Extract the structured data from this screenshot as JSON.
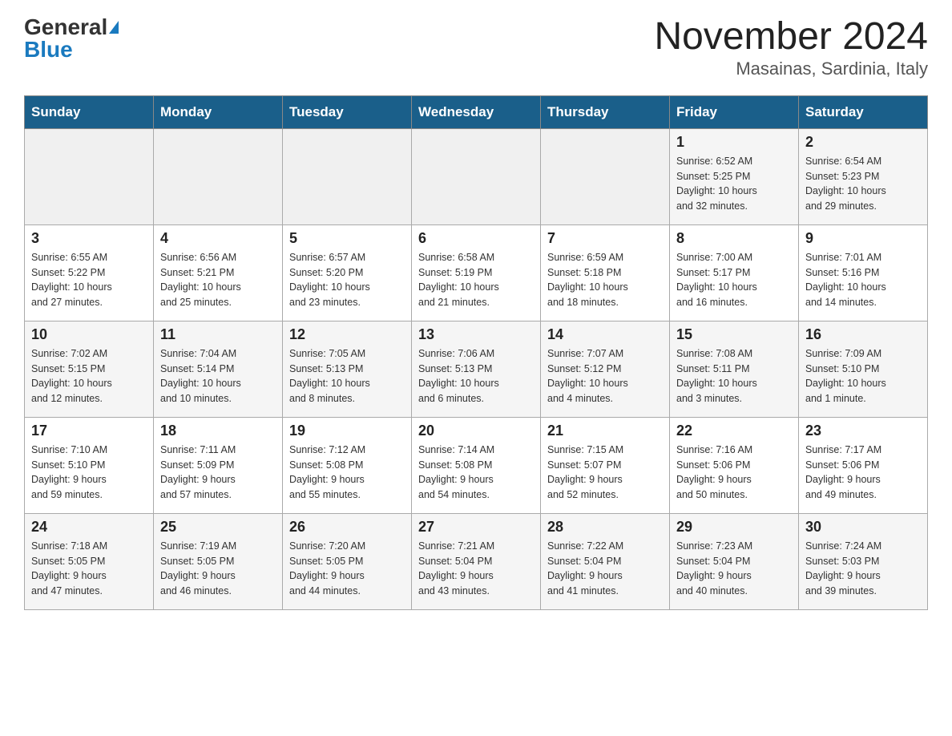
{
  "header": {
    "logo_general": "General",
    "logo_blue": "Blue",
    "month_title": "November 2024",
    "location": "Masainas, Sardinia, Italy"
  },
  "days_of_week": [
    "Sunday",
    "Monday",
    "Tuesday",
    "Wednesday",
    "Thursday",
    "Friday",
    "Saturday"
  ],
  "weeks": [
    [
      {
        "day": "",
        "info": ""
      },
      {
        "day": "",
        "info": ""
      },
      {
        "day": "",
        "info": ""
      },
      {
        "day": "",
        "info": ""
      },
      {
        "day": "",
        "info": ""
      },
      {
        "day": "1",
        "info": "Sunrise: 6:52 AM\nSunset: 5:25 PM\nDaylight: 10 hours\nand 32 minutes."
      },
      {
        "day": "2",
        "info": "Sunrise: 6:54 AM\nSunset: 5:23 PM\nDaylight: 10 hours\nand 29 minutes."
      }
    ],
    [
      {
        "day": "3",
        "info": "Sunrise: 6:55 AM\nSunset: 5:22 PM\nDaylight: 10 hours\nand 27 minutes."
      },
      {
        "day": "4",
        "info": "Sunrise: 6:56 AM\nSunset: 5:21 PM\nDaylight: 10 hours\nand 25 minutes."
      },
      {
        "day": "5",
        "info": "Sunrise: 6:57 AM\nSunset: 5:20 PM\nDaylight: 10 hours\nand 23 minutes."
      },
      {
        "day": "6",
        "info": "Sunrise: 6:58 AM\nSunset: 5:19 PM\nDaylight: 10 hours\nand 21 minutes."
      },
      {
        "day": "7",
        "info": "Sunrise: 6:59 AM\nSunset: 5:18 PM\nDaylight: 10 hours\nand 18 minutes."
      },
      {
        "day": "8",
        "info": "Sunrise: 7:00 AM\nSunset: 5:17 PM\nDaylight: 10 hours\nand 16 minutes."
      },
      {
        "day": "9",
        "info": "Sunrise: 7:01 AM\nSunset: 5:16 PM\nDaylight: 10 hours\nand 14 minutes."
      }
    ],
    [
      {
        "day": "10",
        "info": "Sunrise: 7:02 AM\nSunset: 5:15 PM\nDaylight: 10 hours\nand 12 minutes."
      },
      {
        "day": "11",
        "info": "Sunrise: 7:04 AM\nSunset: 5:14 PM\nDaylight: 10 hours\nand 10 minutes."
      },
      {
        "day": "12",
        "info": "Sunrise: 7:05 AM\nSunset: 5:13 PM\nDaylight: 10 hours\nand 8 minutes."
      },
      {
        "day": "13",
        "info": "Sunrise: 7:06 AM\nSunset: 5:13 PM\nDaylight: 10 hours\nand 6 minutes."
      },
      {
        "day": "14",
        "info": "Sunrise: 7:07 AM\nSunset: 5:12 PM\nDaylight: 10 hours\nand 4 minutes."
      },
      {
        "day": "15",
        "info": "Sunrise: 7:08 AM\nSunset: 5:11 PM\nDaylight: 10 hours\nand 3 minutes."
      },
      {
        "day": "16",
        "info": "Sunrise: 7:09 AM\nSunset: 5:10 PM\nDaylight: 10 hours\nand 1 minute."
      }
    ],
    [
      {
        "day": "17",
        "info": "Sunrise: 7:10 AM\nSunset: 5:10 PM\nDaylight: 9 hours\nand 59 minutes."
      },
      {
        "day": "18",
        "info": "Sunrise: 7:11 AM\nSunset: 5:09 PM\nDaylight: 9 hours\nand 57 minutes."
      },
      {
        "day": "19",
        "info": "Sunrise: 7:12 AM\nSunset: 5:08 PM\nDaylight: 9 hours\nand 55 minutes."
      },
      {
        "day": "20",
        "info": "Sunrise: 7:14 AM\nSunset: 5:08 PM\nDaylight: 9 hours\nand 54 minutes."
      },
      {
        "day": "21",
        "info": "Sunrise: 7:15 AM\nSunset: 5:07 PM\nDaylight: 9 hours\nand 52 minutes."
      },
      {
        "day": "22",
        "info": "Sunrise: 7:16 AM\nSunset: 5:06 PM\nDaylight: 9 hours\nand 50 minutes."
      },
      {
        "day": "23",
        "info": "Sunrise: 7:17 AM\nSunset: 5:06 PM\nDaylight: 9 hours\nand 49 minutes."
      }
    ],
    [
      {
        "day": "24",
        "info": "Sunrise: 7:18 AM\nSunset: 5:05 PM\nDaylight: 9 hours\nand 47 minutes."
      },
      {
        "day": "25",
        "info": "Sunrise: 7:19 AM\nSunset: 5:05 PM\nDaylight: 9 hours\nand 46 minutes."
      },
      {
        "day": "26",
        "info": "Sunrise: 7:20 AM\nSunset: 5:05 PM\nDaylight: 9 hours\nand 44 minutes."
      },
      {
        "day": "27",
        "info": "Sunrise: 7:21 AM\nSunset: 5:04 PM\nDaylight: 9 hours\nand 43 minutes."
      },
      {
        "day": "28",
        "info": "Sunrise: 7:22 AM\nSunset: 5:04 PM\nDaylight: 9 hours\nand 41 minutes."
      },
      {
        "day": "29",
        "info": "Sunrise: 7:23 AM\nSunset: 5:04 PM\nDaylight: 9 hours\nand 40 minutes."
      },
      {
        "day": "30",
        "info": "Sunrise: 7:24 AM\nSunset: 5:03 PM\nDaylight: 9 hours\nand 39 minutes."
      }
    ]
  ]
}
